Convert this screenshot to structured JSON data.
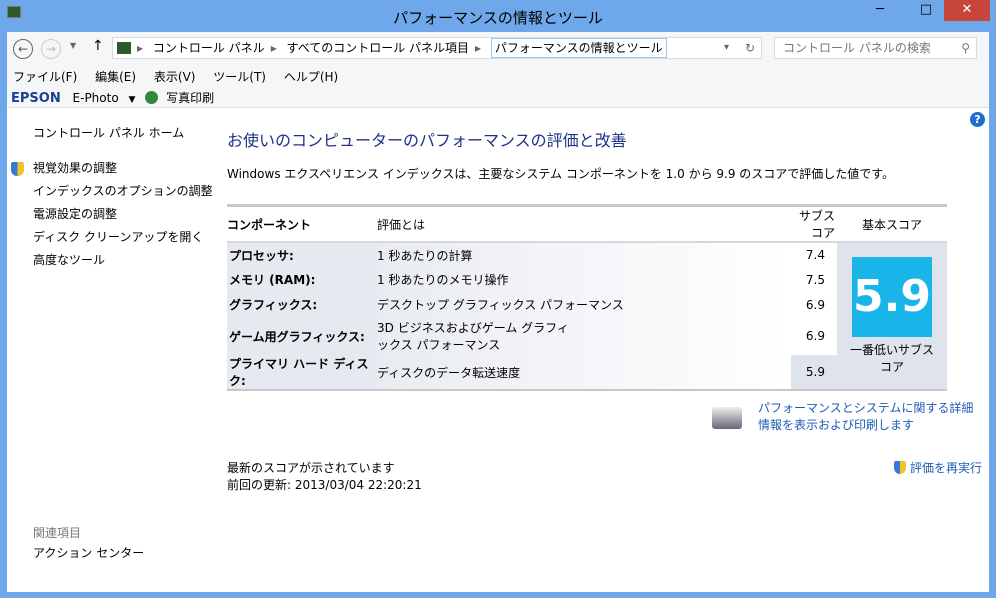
{
  "window": {
    "title": "パフォーマンスの情報とツール",
    "close": "✕"
  },
  "address": {
    "crumbs": [
      "コントロール パネル",
      "すべてのコントロール パネル項目",
      "パフォーマンスの情報とツール"
    ],
    "search_placeholder": "コントロール パネルの検索"
  },
  "menu": [
    "ファイル(F)",
    "編集(E)",
    "表示(V)",
    "ツール(T)",
    "ヘルプ(H)"
  ],
  "epson": {
    "brand": "EPSON",
    "app": "E-Photo",
    "print": "写真印刷"
  },
  "sidebar": {
    "home": "コントロール パネル ホーム",
    "links": [
      "視覚効果の調整",
      "インデックスのオプションの調整",
      "電源設定の調整",
      "ディスク クリーンアップを開く",
      "高度なツール"
    ],
    "related_title": "関連項目",
    "related": [
      "アクション センター"
    ]
  },
  "main": {
    "heading": "お使いのコンピューターのパフォーマンスの評価と改善",
    "description": "Windows エクスペリエンス インデックスは、主要なシステム コンポーネントを 1.0 から 9.9 のスコアで評価した値です。",
    "headers": [
      "コンポーネント",
      "評価とは",
      "サブスコア",
      "基本スコア"
    ],
    "rows": [
      {
        "component": "プロセッサ:",
        "what": "1 秒あたりの計算",
        "score": "7.4"
      },
      {
        "component": "メモリ (RAM):",
        "what": "1 秒あたりのメモリ操作",
        "score": "7.5"
      },
      {
        "component": "グラフィックス:",
        "what": "デスクトップ グラフィックス パフォーマンス",
        "score": "6.9"
      },
      {
        "component": "ゲーム用グラフィックス:",
        "what": "3D ビジネスおよびゲーム グラフィックス パフォーマンス",
        "score": "6.9"
      },
      {
        "component": "プライマリ ハード ディスク:",
        "what": "ディスクのデータ転送速度",
        "score": "5.9"
      }
    ],
    "base_score": "5.9",
    "base_caption": "一番低いサブスコア",
    "details_link": "パフォーマンスとシステムに関する詳細情報を表示および印刷します",
    "status": "最新のスコアが示されています",
    "last_update": "前回の更新: 2013/03/04 22:20:21",
    "rerun": "評価を再実行"
  }
}
